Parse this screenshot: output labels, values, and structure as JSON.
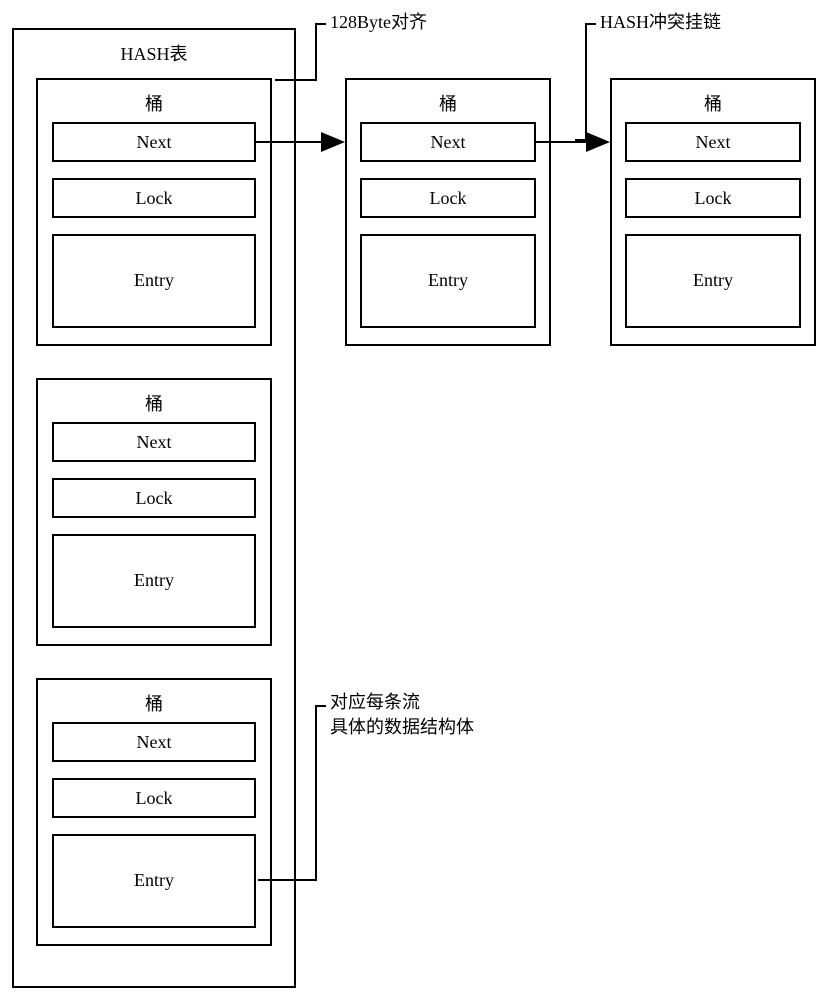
{
  "hashTable": {
    "title": "HASH表"
  },
  "bucket": {
    "title": "桶",
    "next": "Next",
    "lock": "Lock",
    "entry": "Entry"
  },
  "annotations": {
    "align128": "128Byte对齐",
    "collisionChain": "HASH冲突挂链",
    "entryStruct": "对应每条流\n具体的数据结构体"
  }
}
